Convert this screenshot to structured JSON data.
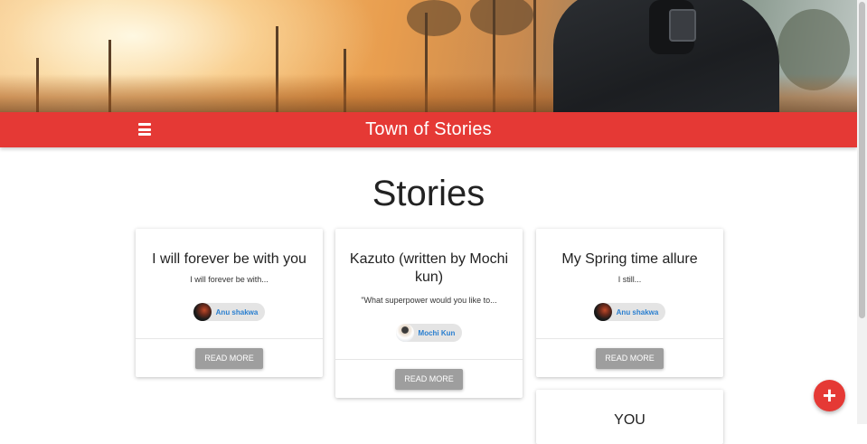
{
  "navbar": {
    "title": "Town of Stories",
    "menu_icon": "menu-icon"
  },
  "page": {
    "heading": "Stories"
  },
  "stories": [
    {
      "title": "I will forever be with you",
      "excerpt": "I will forever be with...",
      "author": "Anu shakwa",
      "action": "READ MORE"
    },
    {
      "title": "Kazuto (written by Mochi kun)",
      "excerpt": "\"What superpower would you like to...",
      "author": "Mochi Kun",
      "action": "READ MORE"
    },
    {
      "title": "My Spring time allure",
      "excerpt": "I still...",
      "author": "Anu shakwa",
      "action": "READ MORE"
    },
    {
      "title": "YOU"
    }
  ],
  "fab": {
    "label": "+",
    "icon": "plus-icon"
  },
  "colors": {
    "accent": "#e53935",
    "button": "#9e9e9e",
    "author_link": "#2a7fd0"
  }
}
